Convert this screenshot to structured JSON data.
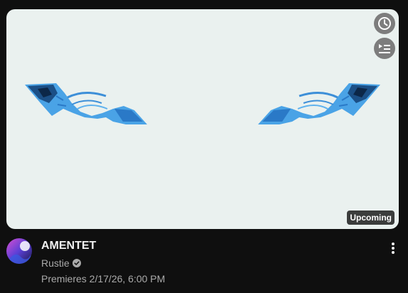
{
  "video": {
    "title": "AMENTET",
    "channel": "Rustie",
    "premiere_text": "Premieres 2/17/26, 6:00 PM",
    "badge": "Upcoming"
  },
  "icons": {
    "watch_later": "clock-icon",
    "add_to_queue": "queue-icon",
    "verified": "verified-check-icon",
    "more": "vertical-dots-icon"
  },
  "colors": {
    "background": "#0f0f0f",
    "thumbnail_bg": "#eaf1ef",
    "eye_blue": "#4aa3e6",
    "secondary_text": "#aaaaaa"
  }
}
